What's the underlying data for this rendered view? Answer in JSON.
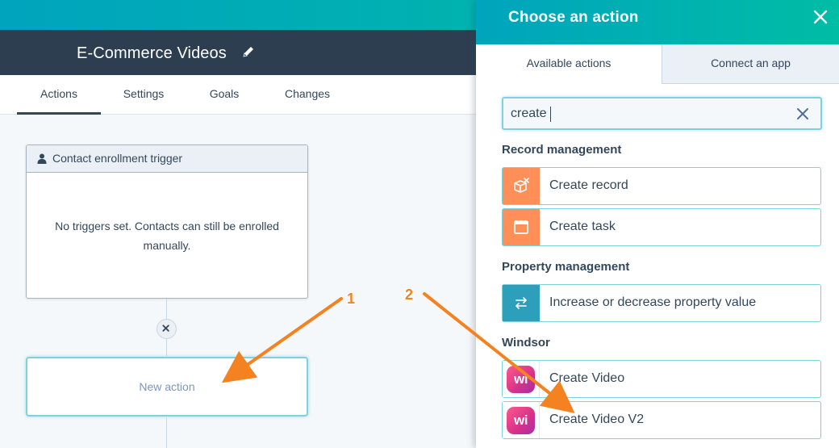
{
  "workflow": {
    "title": "E-Commerce Videos"
  },
  "tabs": [
    {
      "label": "Actions",
      "active": true
    },
    {
      "label": "Settings",
      "active": false
    },
    {
      "label": "Goals",
      "active": false
    },
    {
      "label": "Changes",
      "active": false
    }
  ],
  "trigger_card": {
    "title": "Contact enrollment trigger",
    "body": "No triggers set. Contacts can still be enrolled manually."
  },
  "new_action_card": {
    "label": "New action"
  },
  "panel": {
    "title": "Choose an action",
    "tabs": [
      {
        "label": "Available actions",
        "active": true
      },
      {
        "label": "Connect an app",
        "active": false
      }
    ],
    "search": {
      "value": "create"
    },
    "sections": [
      {
        "title": "Record management",
        "items": [
          {
            "label": "Create record",
            "icon": "cube-icon",
            "icon_color": "#ff8f59"
          },
          {
            "label": "Create task",
            "icon": "task-icon",
            "icon_color": "#ff8f59"
          }
        ]
      },
      {
        "title": "Property management",
        "items": [
          {
            "label": "Increase or decrease property value",
            "icon": "swap-arrows-icon",
            "icon_color": "#2d9fbb"
          }
        ]
      },
      {
        "title": "Windsor",
        "items": [
          {
            "label": "Create Video",
            "icon": "windsor-logo-icon",
            "logo_text": "wi"
          },
          {
            "label": "Create Video V2",
            "icon": "windsor-logo-icon",
            "logo_text": "wi"
          }
        ]
      }
    ]
  },
  "annotations": [
    {
      "number": "1",
      "points_to": "New action"
    },
    {
      "number": "2",
      "points_to": "Create Video V2"
    }
  ],
  "colors": {
    "header_teal_start": "#00a4bd",
    "header_teal_end": "#00bda5",
    "dark_header": "#2d3e50",
    "text": "#33475b",
    "annotation_orange": "#f58220"
  }
}
